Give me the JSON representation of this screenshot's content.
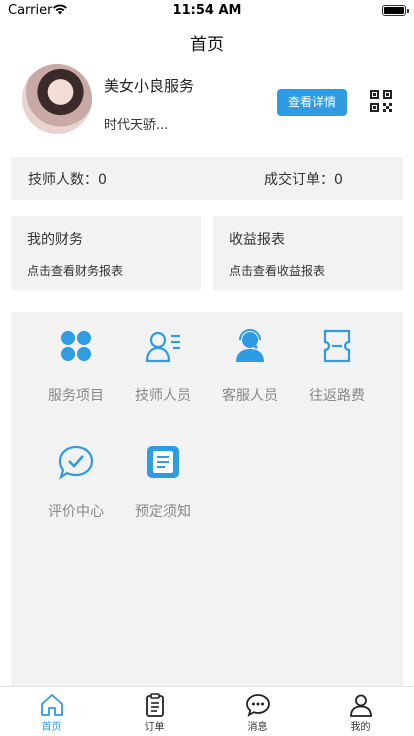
{
  "status_bar": {
    "carrier": "Carrier",
    "time": "11:54 AM",
    "battery_level": 1.0
  },
  "nav": {
    "title": "首页"
  },
  "profile": {
    "name": "美女小良服务",
    "subtitle": "时代天骄...",
    "detail_button": "查看详情",
    "qr_icon": "qr-code-icon"
  },
  "stats": {
    "technician_count_label": "技师人数：",
    "technician_count": "0",
    "orders_label": "成交订单：",
    "orders": "0"
  },
  "cards": [
    {
      "title": "我的财务",
      "subtitle": "点击查看财务报表"
    },
    {
      "title": "收益报表",
      "subtitle": "点击查看收益报表"
    }
  ],
  "grid": [
    {
      "label": "服务项目",
      "icon": "clover-icon"
    },
    {
      "label": "技师人员",
      "icon": "person-list-icon"
    },
    {
      "label": "客服人员",
      "icon": "headset-agent-icon"
    },
    {
      "label": "往返路费",
      "icon": "ticket-icon"
    },
    {
      "label": "评价中心",
      "icon": "chat-check-icon"
    },
    {
      "label": "预定须知",
      "icon": "document-icon"
    }
  ],
  "tabs": [
    {
      "label": "首页",
      "icon": "home-icon",
      "active": true
    },
    {
      "label": "订单",
      "icon": "clipboard-icon",
      "active": false
    },
    {
      "label": "消息",
      "icon": "message-icon",
      "active": false
    },
    {
      "label": "我的",
      "icon": "user-icon",
      "active": false
    }
  ],
  "colors": {
    "accent": "#2e9be3",
    "panel": "#f2f2f2",
    "label_gray": "#888888"
  }
}
